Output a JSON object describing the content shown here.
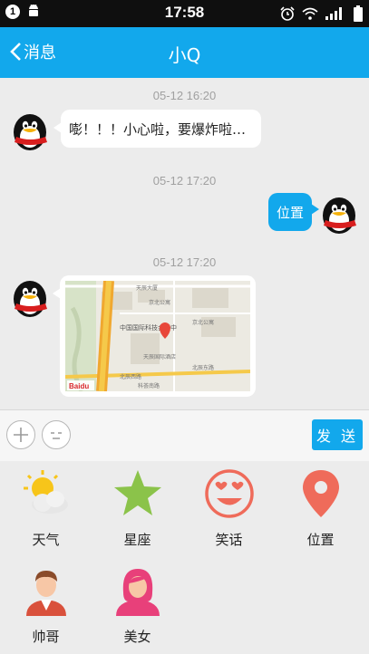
{
  "status_bar": {
    "badge": "1",
    "time": "17:58"
  },
  "nav": {
    "back_label": "消息",
    "title": "小Q"
  },
  "messages": [
    {
      "timestamp": "05-12 16:20",
      "side": "left",
      "text": "嘭！！！小心啦，要爆炸啦…"
    },
    {
      "timestamp": "05-12 17:20",
      "side": "right",
      "text": "位置"
    },
    {
      "timestamp": "05-12 17:20",
      "side": "left",
      "type": "map",
      "map_labels": [
        "中国国际科技会展中",
        "天辰大厦",
        "京北公寓",
        "京北公寓",
        "天辰国际酒店",
        "北辰东路",
        "北辰西路",
        "科荟南路",
        "Baidu"
      ]
    }
  ],
  "input": {
    "send_label": "发 送"
  },
  "panel": {
    "items": [
      {
        "label": "天气",
        "icon": "weather-icon"
      },
      {
        "label": "星座",
        "icon": "star-icon"
      },
      {
        "label": "笑话",
        "icon": "joke-smiley-icon"
      },
      {
        "label": "位置",
        "icon": "location-pin-icon"
      },
      {
        "label": "帅哥",
        "icon": "handsome-guy-icon"
      },
      {
        "label": "美女",
        "icon": "beauty-girl-icon"
      }
    ]
  },
  "colors": {
    "accent": "#12a8ec",
    "star": "#8bc34a",
    "coral": "#ef6b5a"
  }
}
